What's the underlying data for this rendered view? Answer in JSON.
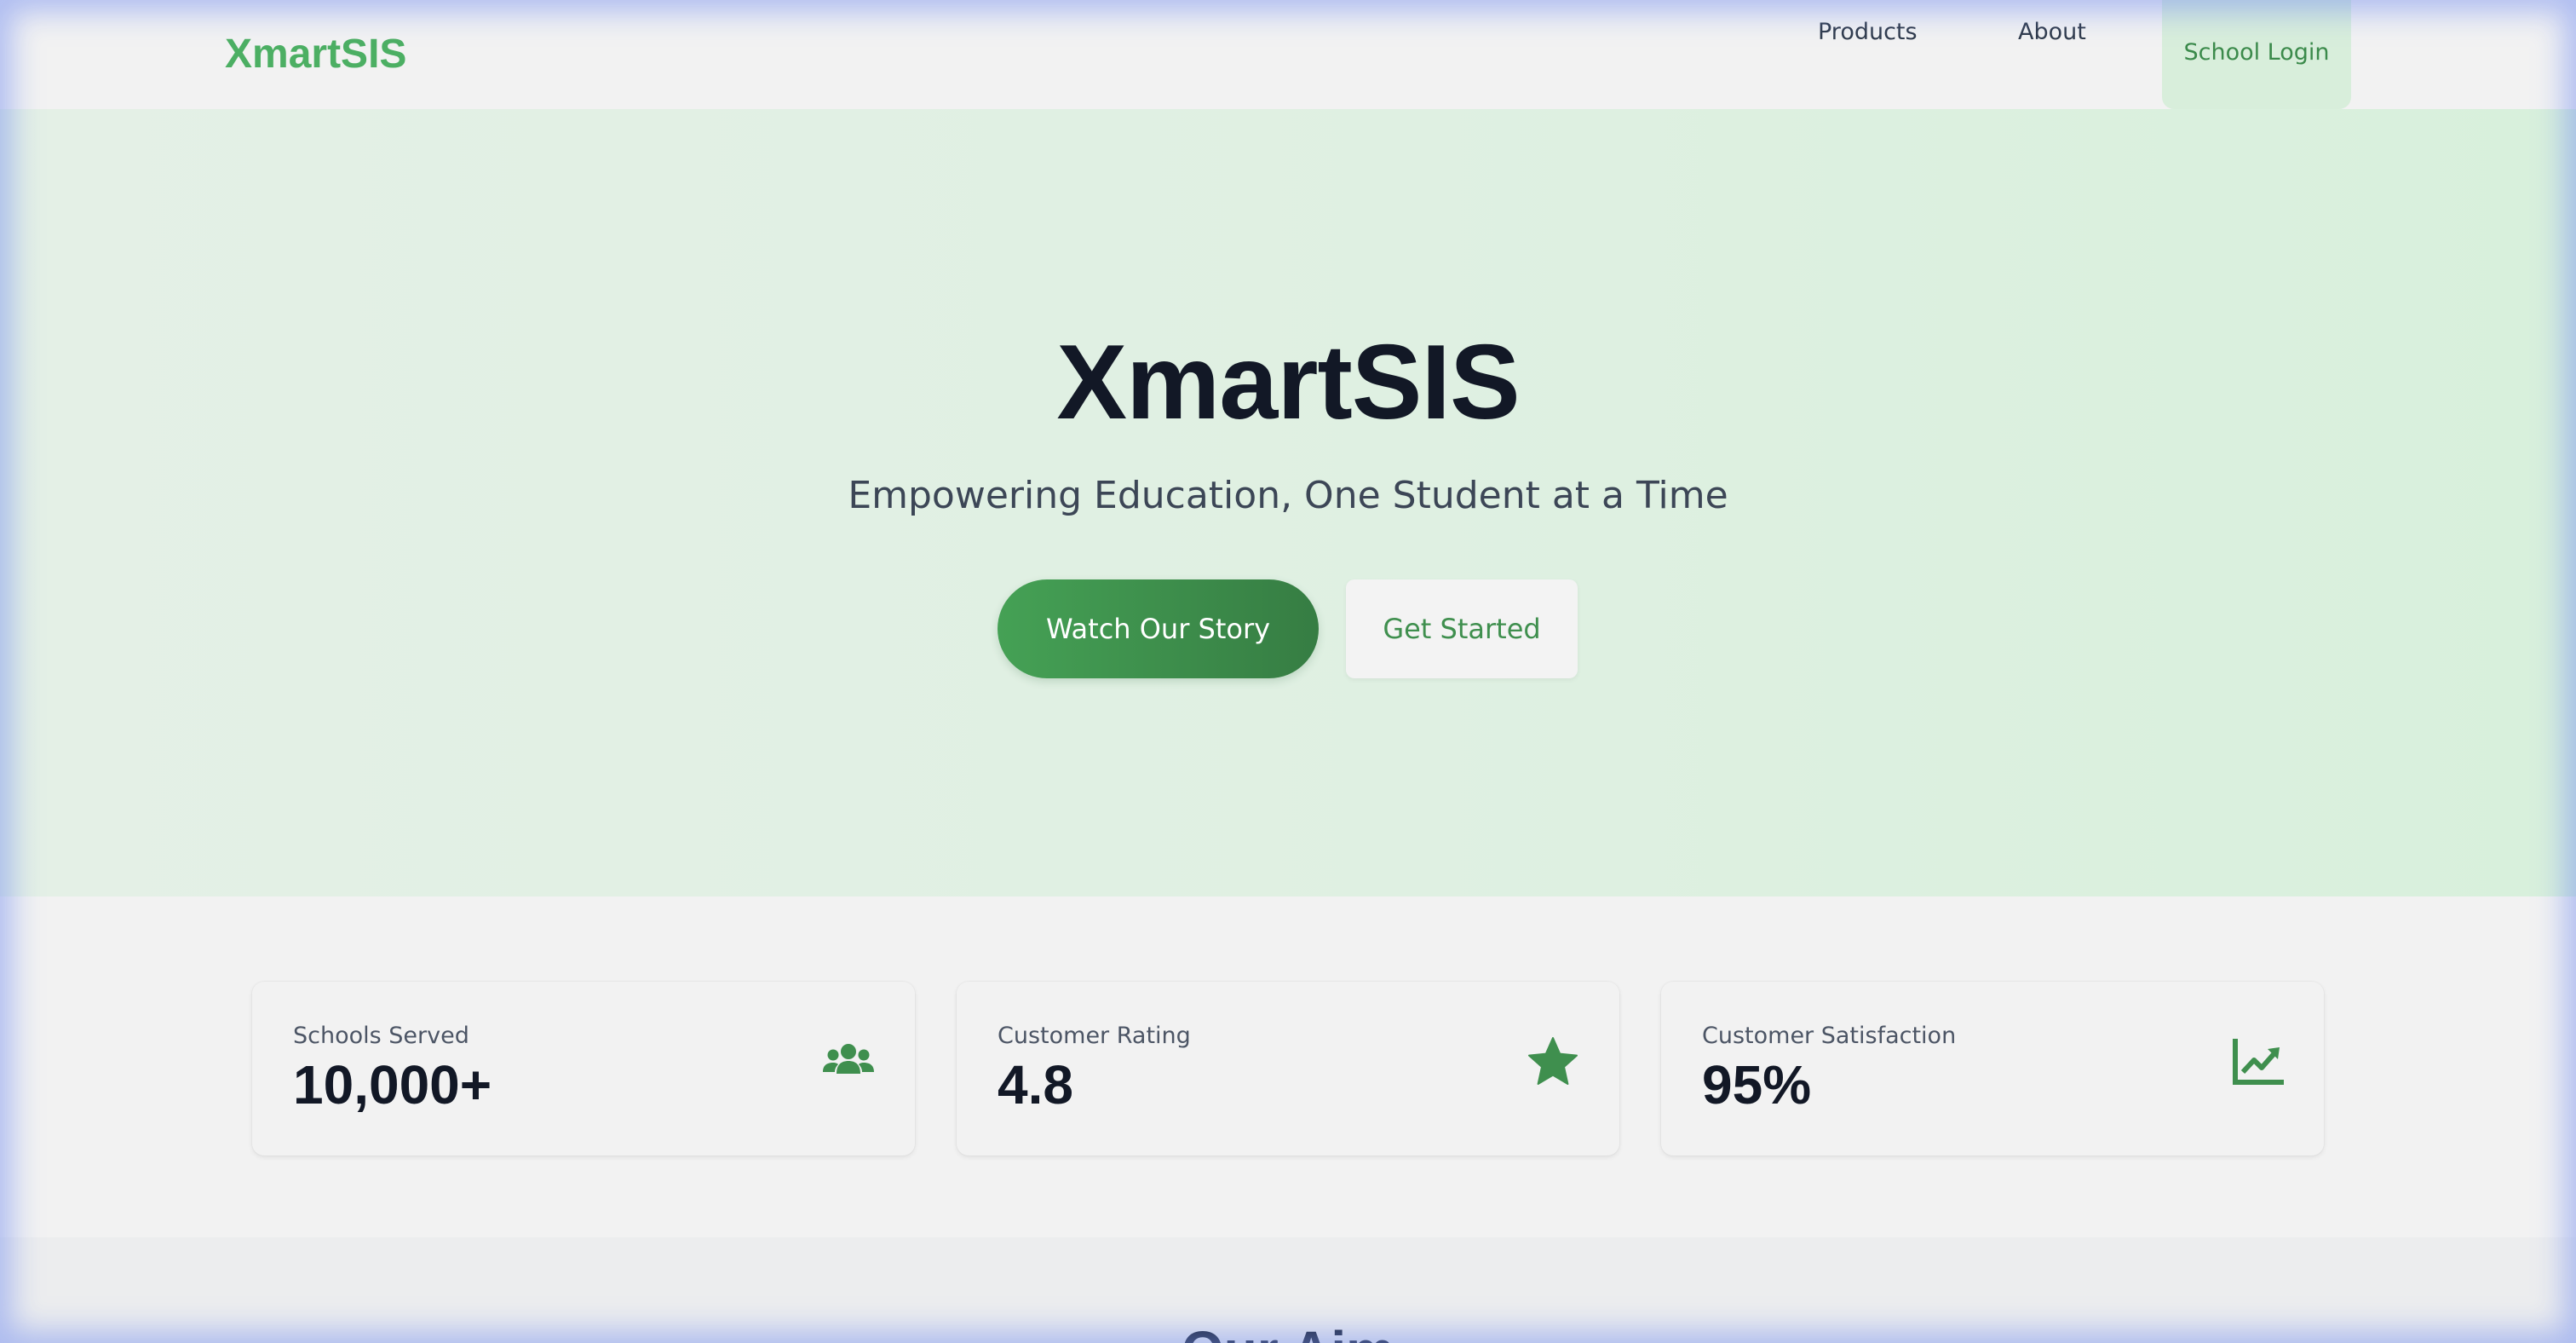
{
  "nav": {
    "brand": "XmartSIS",
    "products": "Products",
    "about": "About",
    "login": "School Login"
  },
  "hero": {
    "title": "XmartSIS",
    "subtitle": "Empowering Education, One Student at a Time",
    "primary_button": "Watch Our Story",
    "secondary_button": "Get Started"
  },
  "stats": [
    {
      "label": "Schools Served",
      "value": "10,000+",
      "icon": "users-icon"
    },
    {
      "label": "Customer Rating",
      "value": "4.8",
      "icon": "star-icon"
    },
    {
      "label": "Customer Satisfaction",
      "value": "95%",
      "icon": "chart-line-icon"
    }
  ],
  "aim": {
    "title": "Our Aim"
  },
  "colors": {
    "brand_green": "#4caf63",
    "accent_green": "#3f8f4e",
    "button_gradient_start": "#45a155",
    "button_gradient_end": "#367d43",
    "hero_background": "#dff0e2",
    "text_dark": "#121826"
  }
}
